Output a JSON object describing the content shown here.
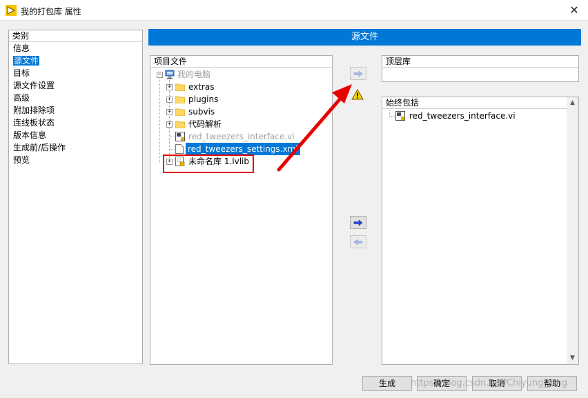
{
  "window": {
    "title": "我的打包库 属性",
    "close_glyph": "✕"
  },
  "categories": {
    "header": "类别",
    "items": [
      "信息",
      "源文件",
      "目标",
      "源文件设置",
      "高级",
      "附加排除项",
      "连线板状态",
      "版本信息",
      "生成前/后操作",
      "预览"
    ],
    "selected_index": 1
  },
  "section_header": "源文件",
  "project_files": {
    "header": "项目文件",
    "root": "我的电脑",
    "folders": [
      "extras",
      "plugins",
      "subvis",
      "代码解析"
    ],
    "files": [
      "red_tweezers_interface.vi",
      "red_tweezers_settings.xml"
    ],
    "library": "未命名库 1.lvlib"
  },
  "top_level": {
    "header": "顶层库"
  },
  "always_include": {
    "header": "始终包括",
    "items": [
      "red_tweezers_interface.vi"
    ]
  },
  "buttons": {
    "build": "生成",
    "ok": "确定",
    "cancel": "取消",
    "help": "帮助"
  },
  "watermark": "https://blog.csdn.net/Chiyung_long",
  "colors": {
    "accent": "#0078d7",
    "annotation": "#e60000",
    "warning": "#f5d000"
  }
}
